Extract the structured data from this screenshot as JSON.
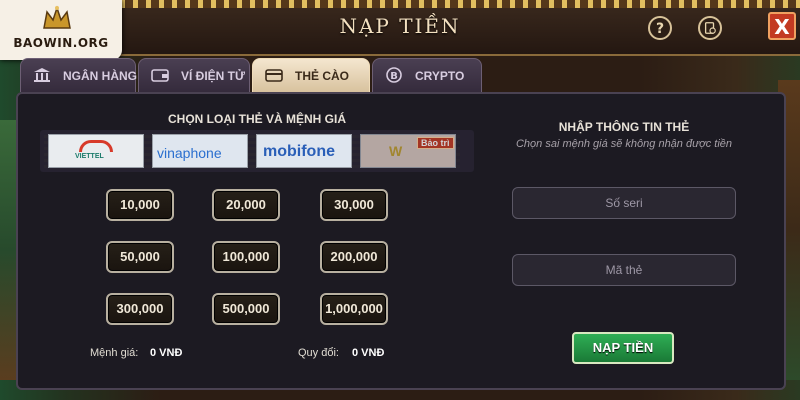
{
  "logo": {
    "text": "BAOWIN.ORG"
  },
  "header": {
    "title": "NẠP TIỀN",
    "help_icon": "question-icon",
    "history_icon": "history-icon",
    "close_label": "X"
  },
  "tabs": [
    {
      "label": "NGÂN HÀNG",
      "icon": "bank-icon",
      "active": false
    },
    {
      "label": "VÍ ĐIỆN TỬ",
      "icon": "wallet-icon",
      "active": false
    },
    {
      "label": "THẺ CÀO",
      "icon": "card-icon",
      "active": true
    },
    {
      "label": "CRYPTO",
      "icon": "bitcoin-icon",
      "active": false
    }
  ],
  "left": {
    "title": "CHỌN LOẠI THẺ VÀ MỆNH GIÁ",
    "carriers": [
      {
        "name": "VIETTEL"
      },
      {
        "name": "vinaphone"
      },
      {
        "name": "mobifone"
      },
      {
        "name": "",
        "badge": "Bảo trì"
      }
    ],
    "amounts": [
      "10,000",
      "20,000",
      "30,000",
      "50,000",
      "100,000",
      "200,000",
      "300,000",
      "500,000",
      "1,000,000"
    ],
    "menh_gia_label": "Mệnh giá:",
    "menh_gia_value": "0 VNĐ",
    "quy_doi_label": "Quy đổi:",
    "quy_doi_value": "0 VNĐ"
  },
  "right": {
    "title": "NHẬP THÔNG TIN THẺ",
    "note": "Chọn sai mệnh giá sẽ không nhận được tiền",
    "serial_placeholder": "Số seri",
    "code_placeholder": "Mã thẻ",
    "submit_label": "NẠP TIỀN"
  },
  "colors": {
    "submit": "#1f8f44",
    "close": "#c33a22",
    "active_tab": "#f4e6cf"
  }
}
